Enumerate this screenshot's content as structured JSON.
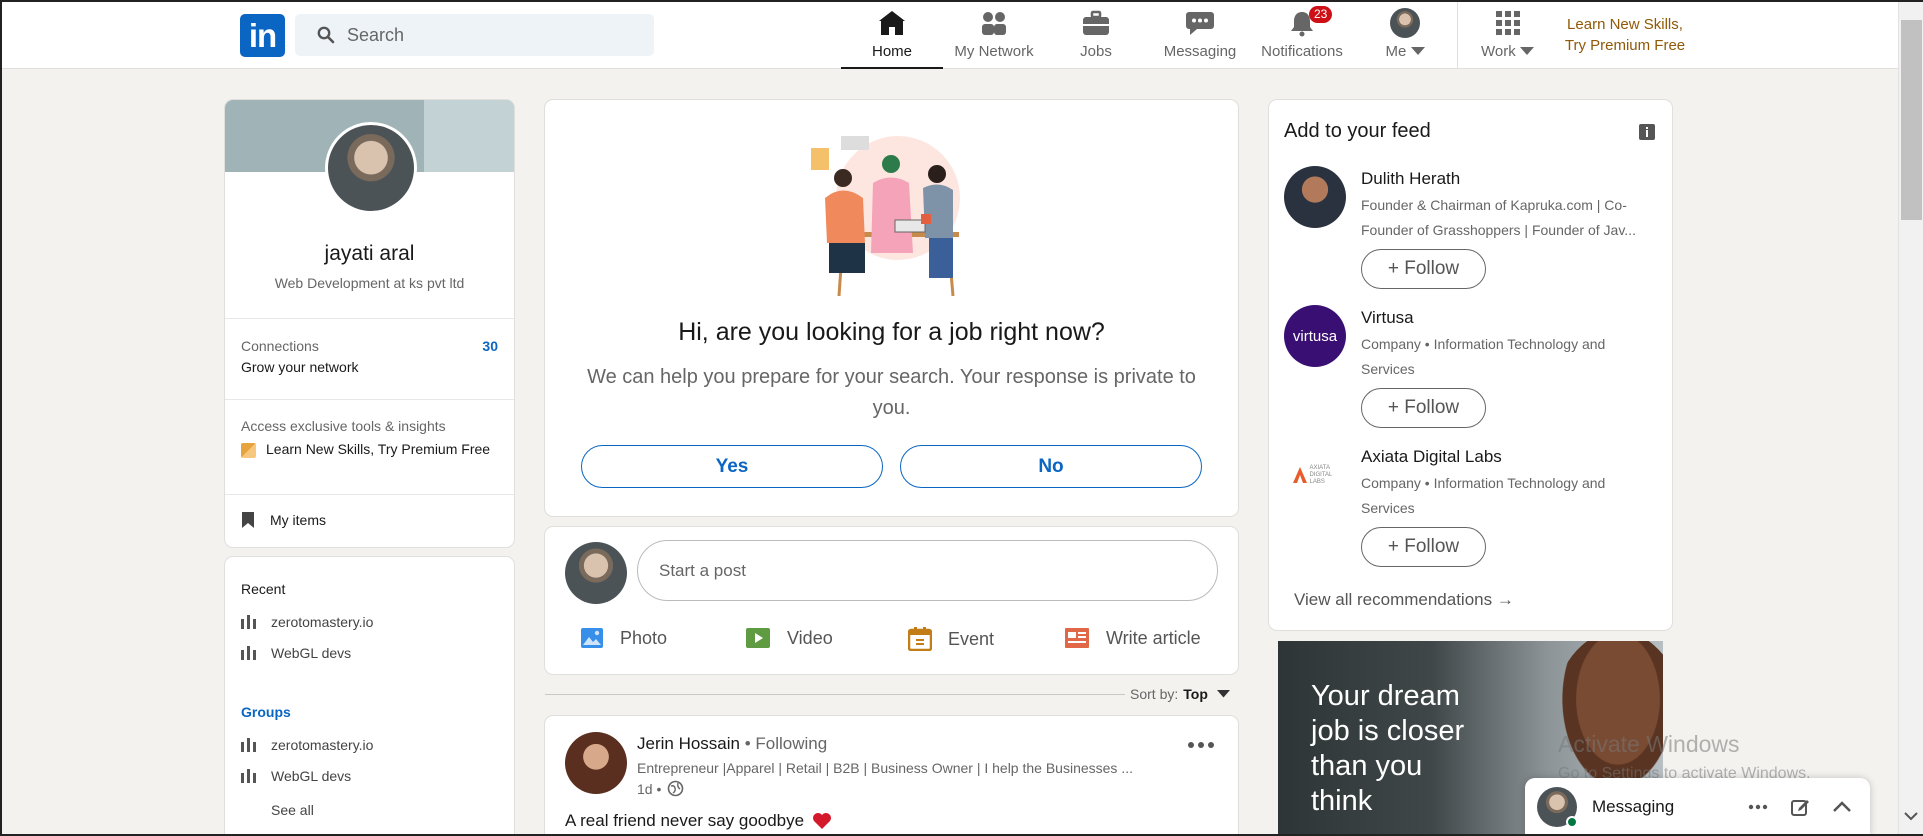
{
  "header": {
    "logo_text": "in",
    "search_placeholder": "Search",
    "nav": [
      {
        "label": "Home"
      },
      {
        "label": "My Network"
      },
      {
        "label": "Jobs"
      },
      {
        "label": "Messaging"
      },
      {
        "label": "Notifications",
        "badge": "23"
      },
      {
        "label": "Me"
      },
      {
        "label": "Work"
      }
    ],
    "premium_line1": "Learn New Skills,",
    "premium_line2": "Try Premium Free"
  },
  "profile": {
    "name": "jayati aral",
    "headline": "Web Development at ks pvt ltd",
    "connections_label": "Connections",
    "connections_count": "30",
    "grow_label": "Grow your network",
    "access_label": "Access exclusive tools & insights",
    "premium_label": "Learn New Skills, Try Premium Free",
    "my_items": "My items"
  },
  "sidebar": {
    "recent_title": "Recent",
    "recent": [
      "zerotomastery.io",
      "WebGL devs"
    ],
    "groups_title": "Groups",
    "groups": [
      "zerotomastery.io",
      "WebGL devs"
    ],
    "see_all": "See all"
  },
  "job_card": {
    "title": "Hi, are you looking for a job right now?",
    "subtitle": "We can help you prepare for your search. Your response is private to you.",
    "yes": "Yes",
    "no": "No"
  },
  "composer": {
    "placeholder": "Start a post",
    "actions": [
      "Photo",
      "Video",
      "Event",
      "Write article"
    ]
  },
  "sort": {
    "label": "Sort by:",
    "value": "Top"
  },
  "post": {
    "author": "Jerin Hossain",
    "relation": "• Following",
    "headline": "Entrepreneur |Apparel | Retail | B2B | Business Owner | I help the Businesses ...",
    "time": "1d •",
    "text": "A real friend never say goodbye"
  },
  "feed": {
    "title": "Add to your feed",
    "recommendations": [
      {
        "name": "Dulith Herath",
        "desc1": "Founder & Chairman of Kapruka.com | Co-",
        "desc2": "Founder of Grasshoppers | Founder of Jav...",
        "follow": "+ Follow"
      },
      {
        "name": "Virtusa",
        "desc1": "Company • Information Technology and",
        "desc2": "Services",
        "follow": "+ Follow",
        "logo": "virtusa"
      },
      {
        "name": "Axiata Digital Labs",
        "desc1": "Company • Information Technology and",
        "desc2": "Services",
        "follow": "+ Follow",
        "logo": "AXIATA DIGITAL LABS"
      }
    ],
    "view_all": "View all recommendations →"
  },
  "ad": {
    "text": [
      "Your dream",
      "job is closer",
      "than you",
      "think"
    ]
  },
  "messaging": {
    "label": "Messaging"
  },
  "watermark": {
    "line1": "Activate Windows",
    "line2": "Go to Settings to activate Windows."
  },
  "colors": {
    "brand": "#0a66c2",
    "premium": "#915907",
    "badge": "#cc1016"
  }
}
